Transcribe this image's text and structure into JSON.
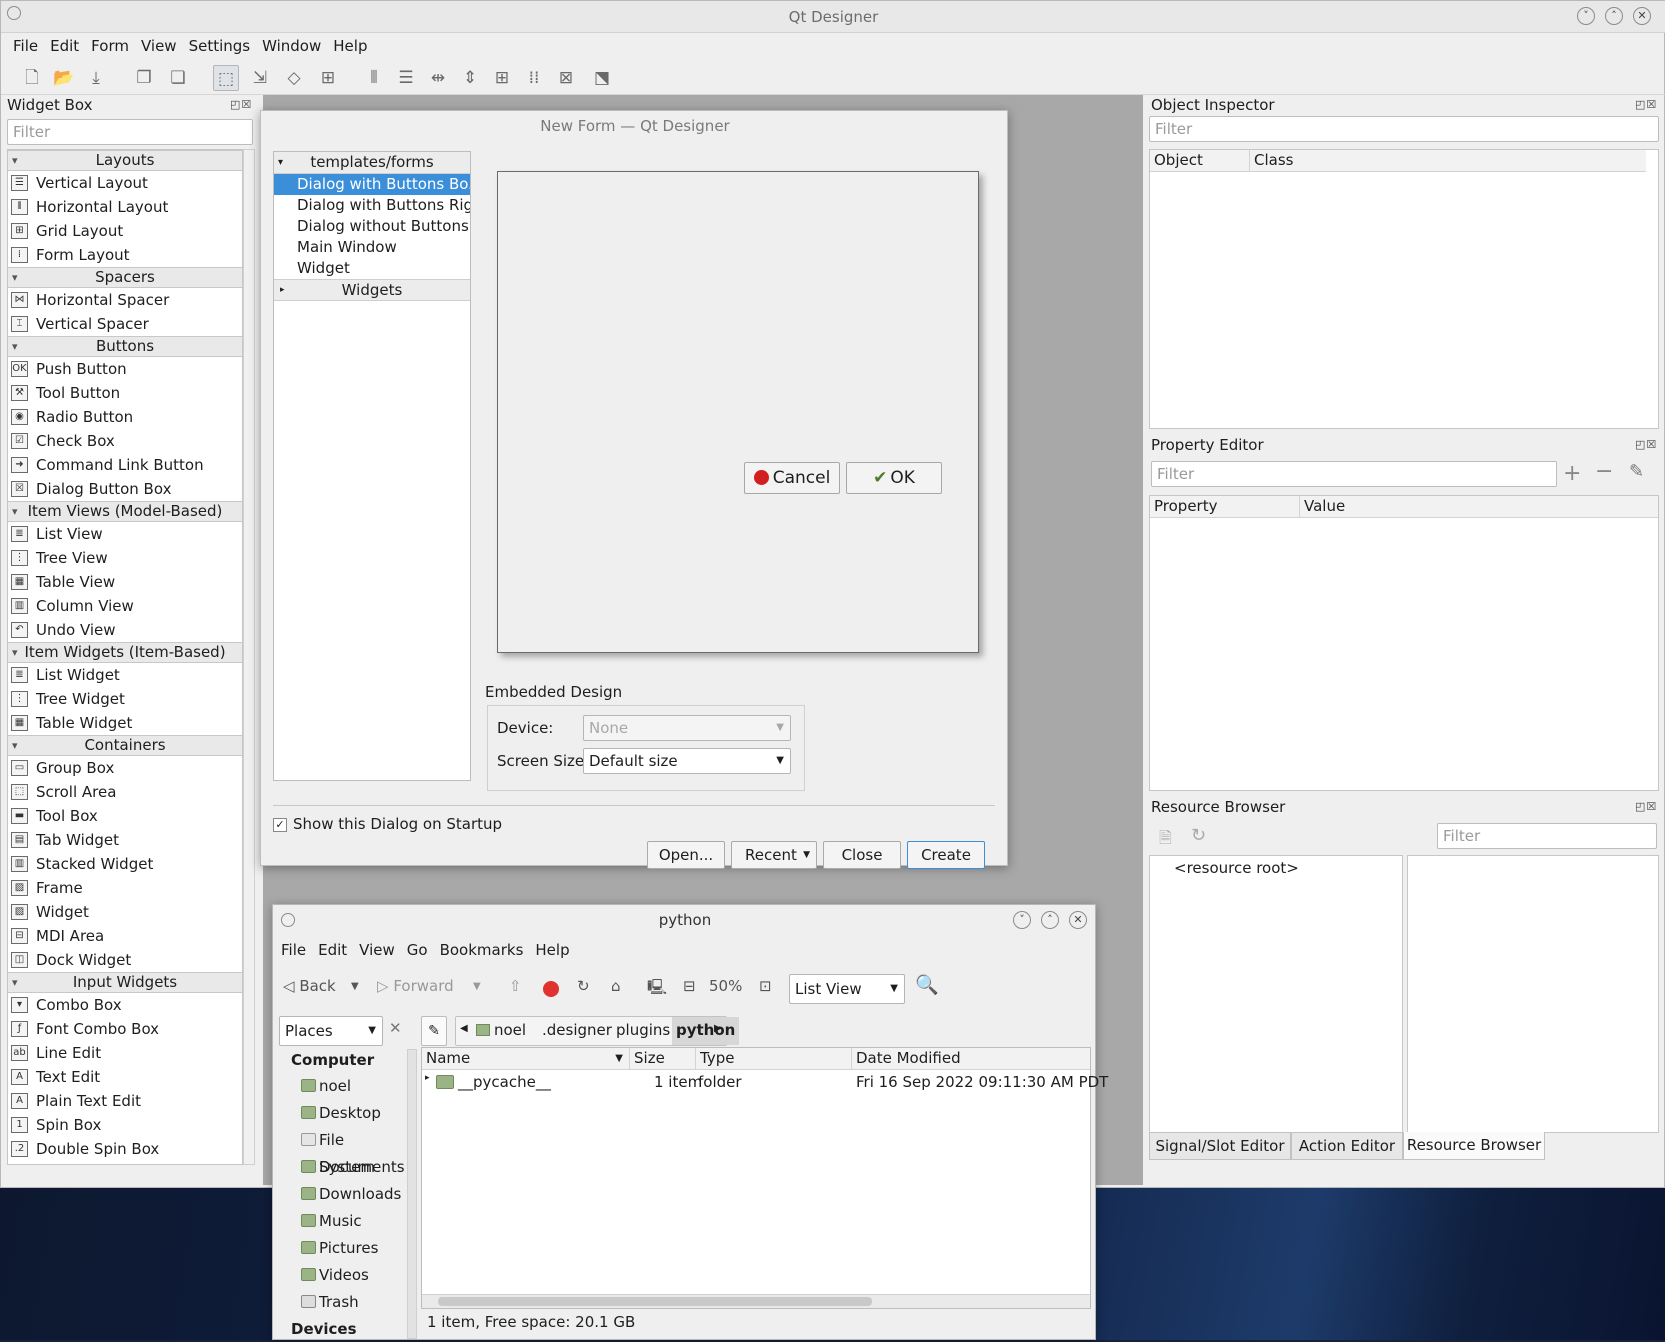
{
  "app": {
    "title": "Qt Designer"
  },
  "menu": [
    "File",
    "Edit",
    "Form",
    "View",
    "Settings",
    "Window",
    "Help"
  ],
  "widget_box": {
    "title": "Widget Box",
    "filter_placeholder": "Filter",
    "groups": [
      {
        "name": "Layouts",
        "items": [
          "Vertical Layout",
          "Horizontal Layout",
          "Grid Layout",
          "Form Layout"
        ]
      },
      {
        "name": "Spacers",
        "items": [
          "Horizontal Spacer",
          "Vertical Spacer"
        ]
      },
      {
        "name": "Buttons",
        "items": [
          "Push Button",
          "Tool Button",
          "Radio Button",
          "Check Box",
          "Command Link Button",
          "Dialog Button Box"
        ]
      },
      {
        "name": "Item Views (Model-Based)",
        "items": [
          "List View",
          "Tree View",
          "Table View",
          "Column View",
          "Undo View"
        ]
      },
      {
        "name": "Item Widgets (Item-Based)",
        "items": [
          "List Widget",
          "Tree Widget",
          "Table Widget"
        ]
      },
      {
        "name": "Containers",
        "items": [
          "Group Box",
          "Scroll Area",
          "Tool Box",
          "Tab Widget",
          "Stacked Widget",
          "Frame",
          "Widget",
          "MDI Area",
          "Dock Widget"
        ]
      },
      {
        "name": "Input Widgets",
        "items": [
          "Combo Box",
          "Font Combo Box",
          "Line Edit",
          "Text Edit",
          "Plain Text Edit",
          "Spin Box",
          "Double Spin Box"
        ]
      }
    ]
  },
  "new_form": {
    "title": "New Form — Qt Designer",
    "tree_header": "templates/forms",
    "templates": [
      "Dialog with Buttons Bo...",
      "Dialog with Buttons Right",
      "Dialog without Buttons",
      "Main Window",
      "Widget"
    ],
    "widgets_header": "Widgets",
    "preview_cancel": "Cancel",
    "preview_ok": "OK",
    "embedded_label": "Embedded Design",
    "device_label": "Device:",
    "device_value": "None",
    "screen_label": "Screen Size:",
    "screen_value": "Default size",
    "startup_label": "Show this Dialog on Startup",
    "buttons": {
      "open": "Open...",
      "recent": "Recent",
      "close": "Close",
      "create": "Create"
    }
  },
  "object_inspector": {
    "title": "Object Inspector",
    "filter_placeholder": "Filter",
    "col_object": "Object",
    "col_class": "Class"
  },
  "property_editor": {
    "title": "Property Editor",
    "filter_placeholder": "Filter",
    "col_property": "Property",
    "col_value": "Value"
  },
  "resource_browser": {
    "title": "Resource Browser",
    "filter_placeholder": "Filter",
    "root": "<resource root>"
  },
  "bottom_tabs": [
    "Signal/Slot Editor",
    "Action Editor",
    "Resource Browser"
  ],
  "file_manager": {
    "title": "python",
    "menu": [
      "File",
      "Edit",
      "View",
      "Go",
      "Bookmarks",
      "Help"
    ],
    "back": "Back",
    "forward": "Forward",
    "zoom": "50%",
    "view_mode": "List View",
    "places_combo": "Places",
    "breadcrumbs": [
      "noel",
      ".designer",
      "plugins",
      "python"
    ],
    "places_header": "Computer",
    "places": [
      "noel",
      "Desktop",
      "File System",
      "Documents",
      "Downloads",
      "Music",
      "Pictures",
      "Videos",
      "Trash"
    ],
    "devices_header": "Devices",
    "columns": [
      "Name",
      "Size",
      "Type",
      "Date Modified"
    ],
    "rows": [
      {
        "name": "__pycache__",
        "size": "1 item",
        "type": "folder",
        "modified": "Fri 16 Sep 2022 09:11:30 AM PDT"
      }
    ],
    "status": "1 item, Free space: 20.1 GB"
  }
}
